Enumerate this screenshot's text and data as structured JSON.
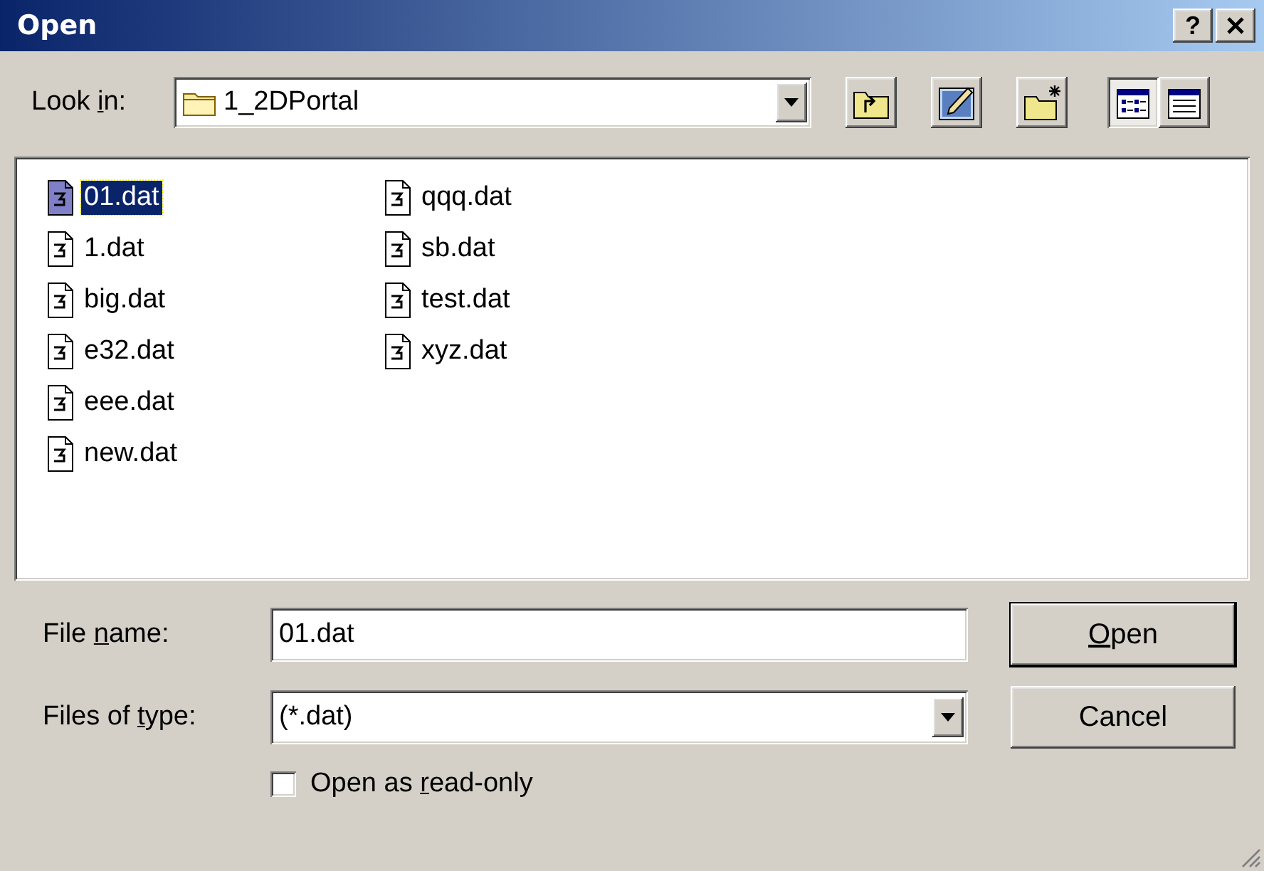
{
  "window": {
    "title": "Open",
    "help": "?"
  },
  "look_in": {
    "label": [
      {
        "text": "Look ",
        "underline": false
      },
      {
        "text": "i",
        "underline": true
      },
      {
        "text": "n:",
        "underline": false
      }
    ],
    "value": "1_2DPortal"
  },
  "toolbar": [
    {
      "kind": "up-folder"
    },
    {
      "kind": "desktop"
    },
    {
      "kind": "new-folder"
    }
  ],
  "view_buttons": [
    {
      "kind": "list",
      "selected": true
    },
    {
      "kind": "details",
      "selected": false
    }
  ],
  "files": [
    {
      "name": "01.dat",
      "selected": true
    },
    {
      "name": "1.dat",
      "selected": false
    },
    {
      "name": "big.dat",
      "selected": false
    },
    {
      "name": "e32.dat",
      "selected": false
    },
    {
      "name": "eee.dat",
      "selected": false
    },
    {
      "name": "new.dat",
      "selected": false
    },
    {
      "name": "qqq.dat",
      "selected": false
    },
    {
      "name": "sb.dat",
      "selected": false
    },
    {
      "name": "test.dat",
      "selected": false
    },
    {
      "name": "xyz.dat",
      "selected": false
    }
  ],
  "file_name": {
    "label": [
      {
        "text": "File ",
        "underline": false
      },
      {
        "text": "n",
        "underline": true
      },
      {
        "text": "ame:",
        "underline": false
      }
    ],
    "value": "01.dat"
  },
  "file_type": {
    "label": [
      {
        "text": "Files of ",
        "underline": false
      },
      {
        "text": "t",
        "underline": true
      },
      {
        "text": "ype:",
        "underline": false
      }
    ],
    "value": "(*.dat)"
  },
  "read_only": {
    "label": [
      {
        "text": "Open as ",
        "underline": false
      },
      {
        "text": "r",
        "underline": true
      },
      {
        "text": "ead-only",
        "underline": false
      }
    ],
    "checked": false
  },
  "buttons": [
    {
      "label": [
        {
          "text": "O",
          "underline": true
        },
        {
          "text": "pen",
          "underline": false
        }
      ],
      "default": true
    },
    {
      "label": [
        {
          "text": "Cancel",
          "underline": false
        }
      ],
      "default": false
    }
  ]
}
